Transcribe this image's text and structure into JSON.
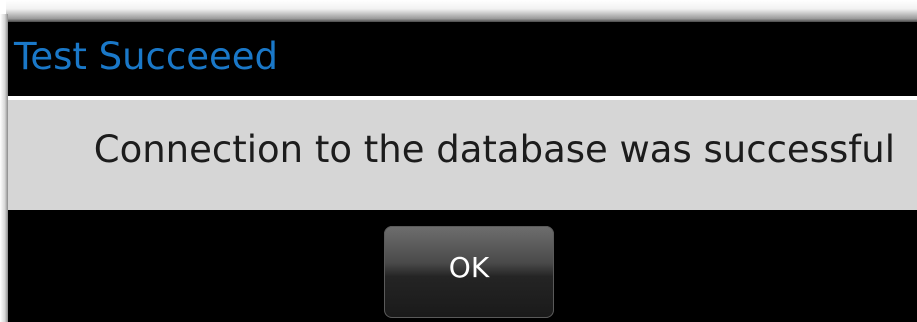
{
  "dialog": {
    "title": "Test Succeeed",
    "message": "Connection to the database was successful",
    "ok_label": "OK"
  },
  "colors": {
    "title_text": "#1a78c8",
    "dialog_background": "#000000",
    "message_band": "#d6d6d6",
    "message_text": "#1c1c1c",
    "button_text": "#ffffff"
  }
}
